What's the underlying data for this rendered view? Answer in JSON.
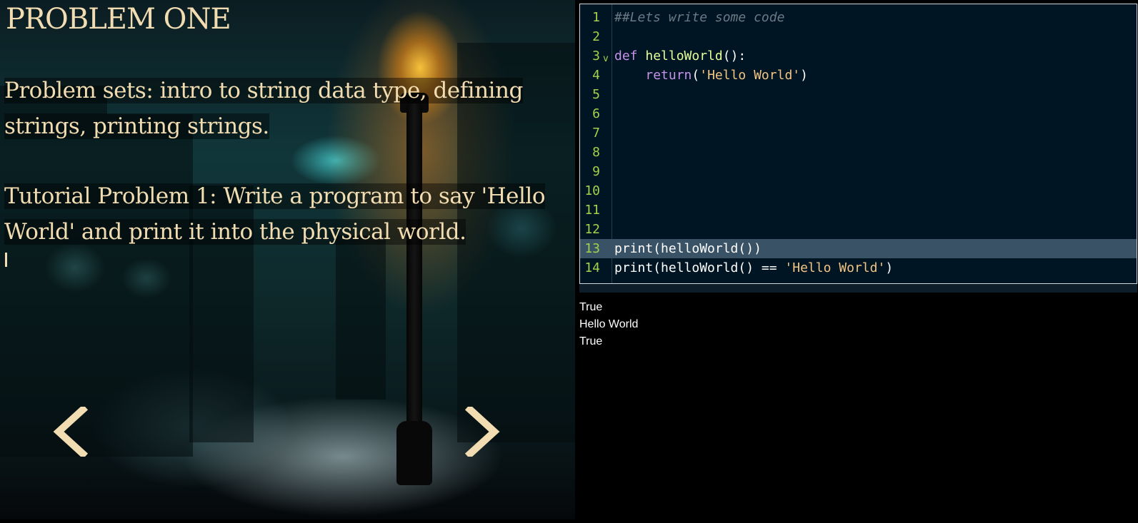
{
  "lesson": {
    "title": "PROBLEM ONE",
    "intro": "Problem sets: intro to string data type, defining strings, printing strings.",
    "task": "Tutorial Problem 1: Write a program to say 'Hello World' and print it into the physical world."
  },
  "navigation": {
    "prev_icon": "chevron-left-icon",
    "next_icon": "chevron-right-icon",
    "arrow_color": "#f2dcb1"
  },
  "editor": {
    "active_line": 13,
    "lines": [
      {
        "num": "1",
        "code": "##Lets write some code"
      },
      {
        "num": "2",
        "code": ""
      },
      {
        "num": "3",
        "code": "def helloWorld():",
        "fold": "v"
      },
      {
        "num": "4",
        "code": "    return('Hello World')"
      },
      {
        "num": "5",
        "code": ""
      },
      {
        "num": "6",
        "code": ""
      },
      {
        "num": "7",
        "code": ""
      },
      {
        "num": "8",
        "code": ""
      },
      {
        "num": "9",
        "code": ""
      },
      {
        "num": "10",
        "code": ""
      },
      {
        "num": "11",
        "code": ""
      },
      {
        "num": "12",
        "code": ""
      },
      {
        "num": "13",
        "code": "print(helloWorld())"
      },
      {
        "num": "14",
        "code": "print(helloWorld() == 'Hello World')"
      }
    ],
    "tokens": {
      "l1_comment": "##Lets write some code",
      "l3_def": "def",
      "l3_name": "helloWorld",
      "l3_rest": "():",
      "l4_indent": "    ",
      "l4_return": "return",
      "l4_open": "(",
      "l4_str": "'Hello World'",
      "l4_close": ")",
      "l13_code": "print(helloWorld())",
      "l14_code": "print(helloWorld() == ",
      "l14_str": "'Hello World'",
      "l14_close": ")"
    }
  },
  "output": {
    "lines": [
      "True",
      "Hello World",
      "True"
    ]
  }
}
